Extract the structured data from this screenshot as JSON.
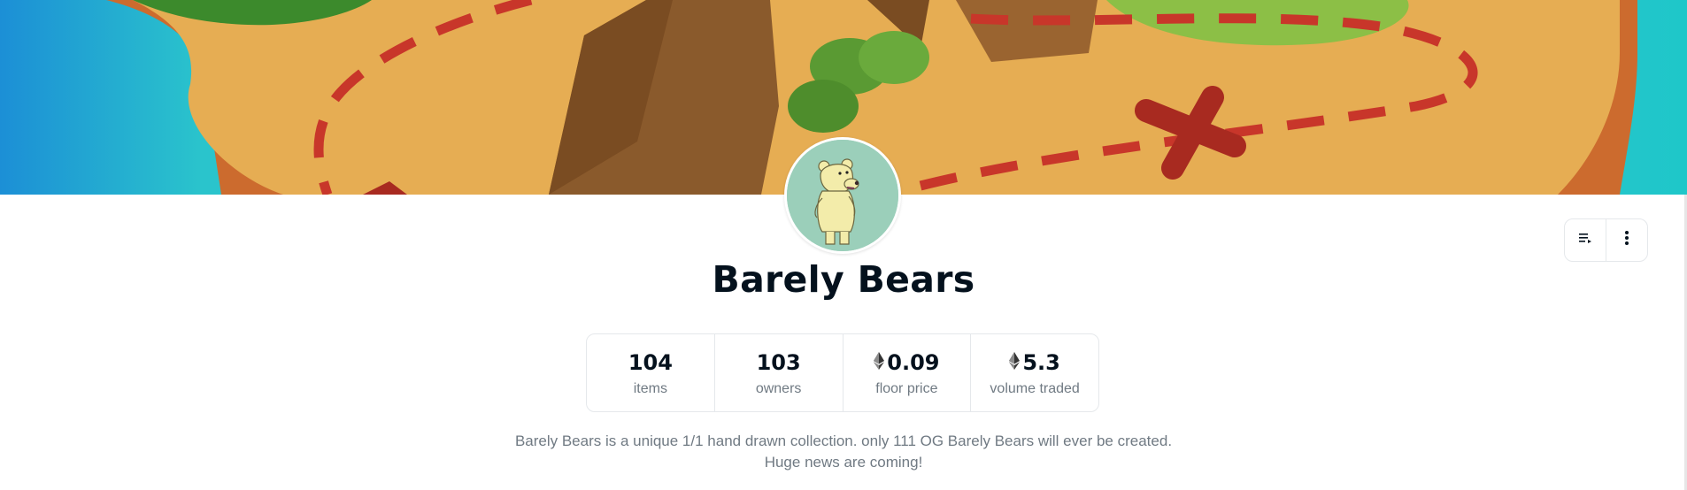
{
  "collection": {
    "name": "Barely Bears",
    "description_lines": [
      "Barely Bears is a unique 1/1 hand drawn collection. only 111 OG Barely Bears will ever be created.",
      "Huge news are coming!"
    ]
  },
  "stats": [
    {
      "value": "104",
      "label": "items",
      "eth": false
    },
    {
      "value": "103",
      "label": "owners",
      "eth": false
    },
    {
      "value": "0.09",
      "label": "floor price",
      "eth": true
    },
    {
      "value": "5.3",
      "label": "volume traded",
      "eth": true
    }
  ],
  "actions": [
    {
      "icon": "activity-list-icon"
    },
    {
      "icon": "more-vertical-icon"
    }
  ],
  "colors": {
    "text_primary": "#04111d",
    "text_secondary": "#707a83",
    "border": "#e5e8eb",
    "avatar_bg": "#9bcfba",
    "banner_sea": "#2ac4cc",
    "banner_sand": "#e6ad53",
    "banner_path": "#c8362a"
  }
}
